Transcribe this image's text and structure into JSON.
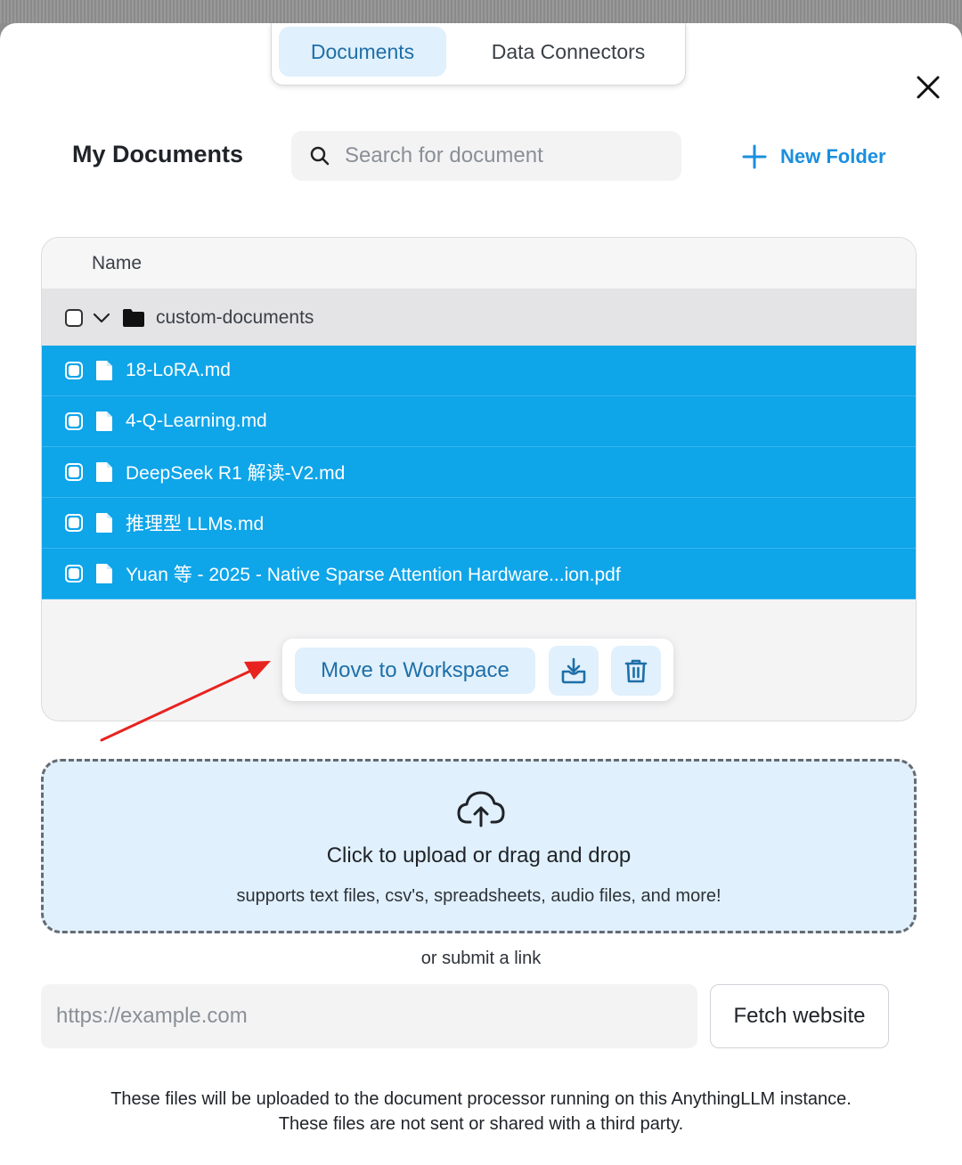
{
  "tabs": [
    {
      "label": "Documents",
      "active": true
    },
    {
      "label": "Data Connectors",
      "active": false
    }
  ],
  "header": {
    "title": "My Documents",
    "search_placeholder": "Search for document",
    "new_folder_label": "New Folder"
  },
  "table": {
    "column_name": "Name",
    "folder": {
      "name": "custom-documents",
      "expanded": true,
      "checked": false
    },
    "files": [
      {
        "name": "18-LoRA.md",
        "selected": true
      },
      {
        "name": "4-Q-Learning.md",
        "selected": true
      },
      {
        "name": "DeepSeek R1 解读-V2.md",
        "selected": true
      },
      {
        "name": "推理型 LLMs.md",
        "selected": true
      },
      {
        "name": "Yuan 等 - 2025 - Native Sparse Attention Hardware...ion.pdf",
        "selected": true
      }
    ]
  },
  "actions": {
    "move_label": "Move to Workspace"
  },
  "upload": {
    "title": "Click to upload or drag and drop",
    "subtitle": "supports text files, csv's, spreadsheets, audio files, and more!",
    "or_link": "or submit a link",
    "url_placeholder": "https://example.com",
    "fetch_label": "Fetch website"
  },
  "footer": {
    "line1": "These files will be uploaded to the document processor running on this AnythingLLM instance.",
    "line2": "These files are not sent or shared with a third party."
  },
  "colors": {
    "accent": "#0ea5e9",
    "accent_light": "#e0f0fc",
    "link_blue": "#1a8fe0",
    "annotation_arrow": "#e8231f"
  }
}
